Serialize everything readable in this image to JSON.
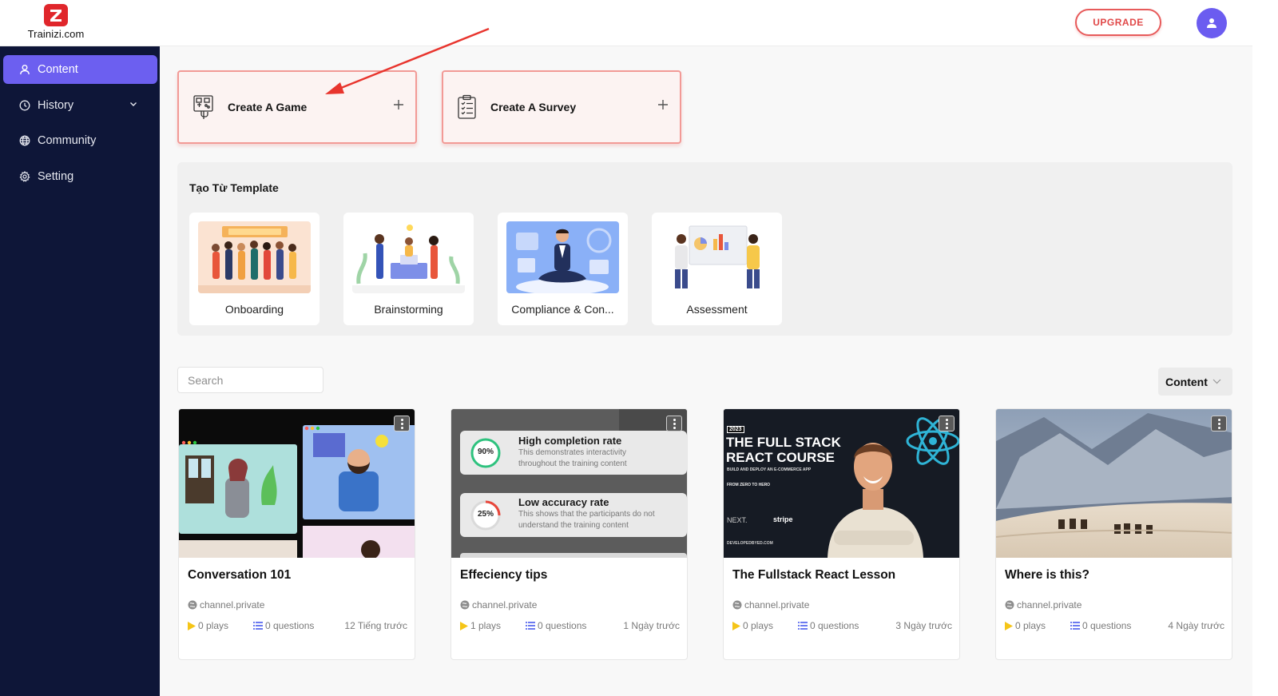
{
  "header": {
    "logo_text": "Trainizi.com",
    "logo_icon": "z-logo-icon",
    "upgrade_label": "UPGRADE",
    "avatar_icon": "user-icon"
  },
  "sidebar": {
    "items": [
      {
        "label": "Content",
        "icon": "user-icon",
        "active": true
      },
      {
        "label": "History",
        "icon": "clock-icon",
        "has_chevron": true
      },
      {
        "label": "Community",
        "icon": "globe-icon"
      },
      {
        "label": "Setting",
        "icon": "gear-icon"
      }
    ]
  },
  "create": {
    "game_label": "Create A Game",
    "survey_label": "Create A Survey"
  },
  "templates": {
    "title": "Tạo Từ Template",
    "items": [
      {
        "label": "Onboarding"
      },
      {
        "label": "Brainstorming"
      },
      {
        "label": "Compliance & Con..."
      },
      {
        "label": "Assessment"
      }
    ]
  },
  "search": {
    "placeholder": "Search"
  },
  "filter": {
    "label": "Content"
  },
  "cards": [
    {
      "title": "Conversation 101",
      "channel": "channel.private",
      "plays": "0 plays",
      "questions": "0 questions",
      "time": "12 Tiếng trước"
    },
    {
      "title": "Effeciency tips",
      "channel": "channel.private",
      "plays": "1 plays",
      "questions": "0 questions",
      "time": "1 Ngày trước",
      "thumb": {
        "row1_percent": "90%",
        "row1_title": "High completion rate",
        "row1_desc1": "This demonstrates interactivity",
        "row1_desc2": "throughout the training content",
        "row2_percent": "25%",
        "row2_title": "Low accuracy rate",
        "row2_desc1": "This shows that the participants do not",
        "row2_desc2": "understand the training content"
      }
    },
    {
      "title": "The Fullstack React Lesson",
      "channel": "channel.private",
      "plays": "0 plays",
      "questions": "0 questions",
      "time": "3 Ngày trước",
      "thumb": {
        "year": "2023",
        "line1": "THE FULL STACK",
        "line2": "REACT COURSE",
        "sub": "BUILD AND DEPLOY AN E-COMMERCE APP",
        "tag": "FROM ZERO TO HERO",
        "next": "NEXT.",
        "stripe": "stripe",
        "site": "DEVELOPEDBYED.COM"
      }
    },
    {
      "title": "Where is this?",
      "channel": "channel.private",
      "plays": "0 plays",
      "questions": "0 questions",
      "time": "4 Ngày trước"
    }
  ],
  "colors": {
    "accent": "#6c5ff0",
    "sidebar": "#0e1638",
    "upgrade": "#e04848",
    "create_border": "#f29a96",
    "play": "#f5c518",
    "question": "#6c7bf0"
  }
}
